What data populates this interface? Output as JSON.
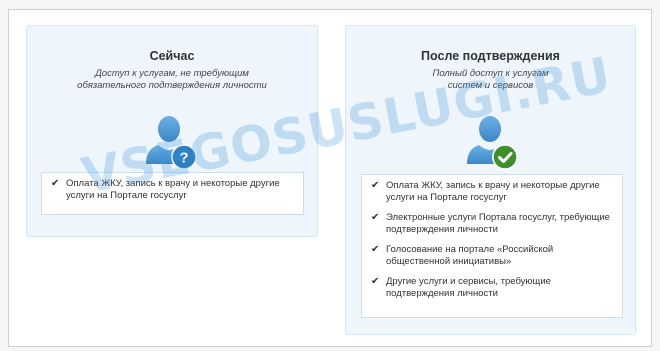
{
  "left_panel": {
    "title": "Сейчас",
    "subtitle_line1": "Доступ к услугам, не требующим",
    "subtitle_line2": "обязательного подтверждения личности",
    "badge_icon": "question-icon",
    "items": [
      "Оплата ЖКУ, запись к врачу и некоторые другие услуги на Портале госуслуг"
    ]
  },
  "right_panel": {
    "title": "После подтверждения",
    "subtitle_line1": "Полный доступ к услугам",
    "subtitle_line2": "систем и сервисов",
    "badge_icon": "checkmark-icon",
    "items": [
      "Оплата ЖКУ, запись к врачу и некоторые другие услуги на Портале госуслуг",
      "Электронные услуги Портала госуслуг, требующие подтверждения личности",
      "Голосование на портале «Российской общественной инициативы»",
      "Другие услуги и сервисы, требующие подтверждения личности"
    ]
  },
  "check_glyph": "✔",
  "watermark": "VSEGOSUSLUGI.RU",
  "colors": {
    "panel_bg": "#eef5fb",
    "avatar_blue": "#4f9ad6",
    "question_badge": "#2f80c3",
    "check_badge": "#3f8f2c",
    "watermark": "#3692da"
  }
}
